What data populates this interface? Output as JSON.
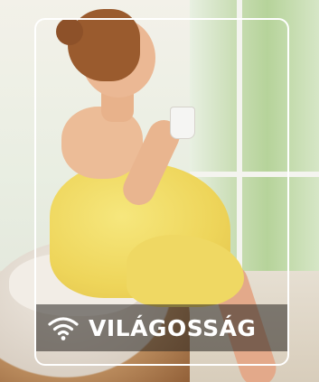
{
  "card": {
    "label": "VILÁGOSSÁG",
    "icon": "wifi-icon",
    "frame_color": "#ffffff",
    "label_bar_color": "rgba(40, 36, 32, 0.55)"
  }
}
